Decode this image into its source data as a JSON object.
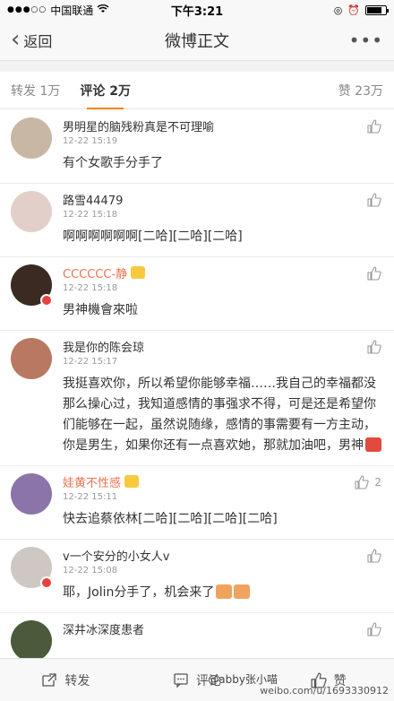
{
  "status_bar": {
    "carrier": "中国联通",
    "time": "下午3:21",
    "battery_level": 0.8
  },
  "nav": {
    "back_label": "返回",
    "title": "微博正文",
    "more_label": "•••"
  },
  "tabs": [
    {
      "label": "转发 1万",
      "active": false
    },
    {
      "label": "评论 2万",
      "active": true
    }
  ],
  "likes_tab": {
    "label": "赞 23万"
  },
  "comments": [
    {
      "name": "男明星的脑残粉真是不可理喻",
      "time": "12-22 15:19",
      "text": "有个女歌手分手了",
      "vip": false,
      "avatar_color": "#c9b7a6"
    },
    {
      "name": "路雪44479",
      "time": "12-22 15:18",
      "text": "啊啊啊啊啊啊[二哈][二哈][二哈]",
      "vip": false,
      "avatar_color": "#e3cfc9"
    },
    {
      "name": "CCCCCC-静",
      "time": "12-22 15:18",
      "text": "男神機會來啦",
      "vip": true,
      "avatar_color": "#3a2a22"
    },
    {
      "name": "我是你的陈会琼",
      "time": "12-22 15:17",
      "text": "我挺喜欢你，所以希望你能够幸福……我自己的幸福都没那么操心过，我知道感情的事强求不得，可是还是希望你们能够在一起，虽然说随缘，感情的事需要有一方主动，你是男生，如果你还有一点喜欢她，那就加油吧，男神",
      "vip": false,
      "avatar_color": "#b97862"
    },
    {
      "name": "娃黄不性感",
      "time": "12-22 15:11",
      "text": "快去追蔡依林[二哈][二哈][二哈][二哈]",
      "vip": true,
      "avatar_color": "#8a74a8",
      "likes": "2"
    },
    {
      "name": "v一个安分的小女人v",
      "time": "12-22 15:08",
      "text": "耶，Jolin分手了，机会来了",
      "vip": false,
      "avatar_color": "#cfc7c3"
    },
    {
      "name": "深井冰深度患者",
      "time": "",
      "text": "",
      "vip": false,
      "avatar_color": "#4a5a3a"
    }
  ],
  "bottom_bar": {
    "repost_label": "转发",
    "comment_label": "评论",
    "like_label": "赞"
  },
  "watermark": {
    "line1": "@abby张小喵",
    "line2": "weibo.com/u/1693330912"
  },
  "colors": {
    "accent": "#ff8200",
    "vip_name": "#eb7350"
  }
}
